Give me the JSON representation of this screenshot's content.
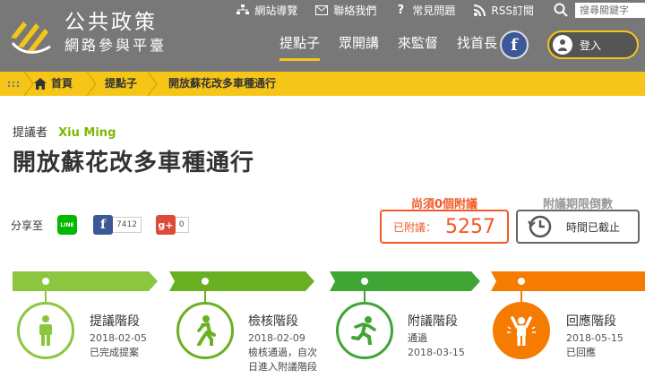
{
  "site": {
    "name": "公共政策",
    "subname": "網路參與平臺"
  },
  "utility": {
    "sitemap": "網站導覽",
    "contact": "聯絡我們",
    "faq": "常見問題",
    "rss": "RSS訂閱",
    "search_placeholder": "搜尋關鍵字"
  },
  "nav": [
    "提點子",
    "眾開講",
    "來監督",
    "找首長"
  ],
  "login": "登入",
  "breadcrumb": [
    "首頁",
    "提點子",
    "開放蘇花改多車種通行"
  ],
  "proposal": {
    "proposer_label": "提議者",
    "proposer": "Xiu Ming",
    "title": "開放蘇花改多車種通行",
    "share_label": "分享至",
    "line_label": "LINE",
    "fb_count": "7412",
    "gplus_count": "0",
    "need_label": "尚須0個附議",
    "count_label": "已附議：",
    "count": "5257",
    "deadline_label": "附議期限倒數",
    "deadline_status": "時間已截止"
  },
  "stages": [
    {
      "name": "提議階段",
      "date": "2018-02-05",
      "note": "已完成提案",
      "color": "#8cc63f"
    },
    {
      "name": "檢核階段",
      "date": "2018-02-09",
      "note": "檢核通過，自次日進入附議階段",
      "color": "#6ab023"
    },
    {
      "name": "附議階段",
      "date": "2018-03-15",
      "note": "通過",
      "color": "#3fa535"
    },
    {
      "name": "回應階段",
      "date": "2018-05-15",
      "note": "已回應",
      "color": "#f57c00"
    }
  ],
  "colors": {
    "header": "#787878",
    "accent": "#f5c518",
    "orange": "#f05a28",
    "green": "#7cb800"
  }
}
